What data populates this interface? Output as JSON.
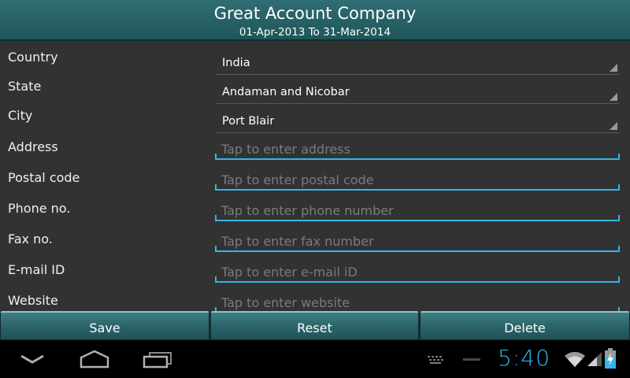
{
  "header": {
    "title": "Great Account Company",
    "subtitle": "01-Apr-2013 To 31-Mar-2014"
  },
  "form": {
    "country": {
      "label": "Country",
      "value": "India"
    },
    "state": {
      "label": "State",
      "value": "Andaman and Nicobar"
    },
    "city": {
      "label": "City",
      "value": "Port Blair"
    },
    "address": {
      "label": "Address",
      "placeholder": "Tap to enter address",
      "value": ""
    },
    "postal_code": {
      "label": "Postal code",
      "placeholder": "Tap to enter postal code",
      "value": ""
    },
    "phone": {
      "label": "Phone no.",
      "placeholder": "Tap to enter phone number",
      "value": ""
    },
    "fax": {
      "label": "Fax no.",
      "placeholder": "Tap to enter fax number",
      "value": ""
    },
    "email": {
      "label": "E-mail ID",
      "placeholder": "Tap to enter e-mail iD",
      "value": ""
    },
    "website": {
      "label": "Website",
      "placeholder": "Tap to enter website",
      "value": ""
    }
  },
  "buttons": {
    "save": "Save",
    "reset": "Reset",
    "delete": "Delete"
  },
  "status_bar": {
    "time": "5:40",
    "icons": [
      "back-icon",
      "home-icon",
      "recent-apps-icon",
      "keyboard-icon",
      "minus-icon",
      "wifi-icon",
      "signal-icon",
      "battery-charging-icon"
    ]
  },
  "colors": {
    "accent": "#33b5e5",
    "header_bg": "#2a6468",
    "background": "#323232"
  }
}
